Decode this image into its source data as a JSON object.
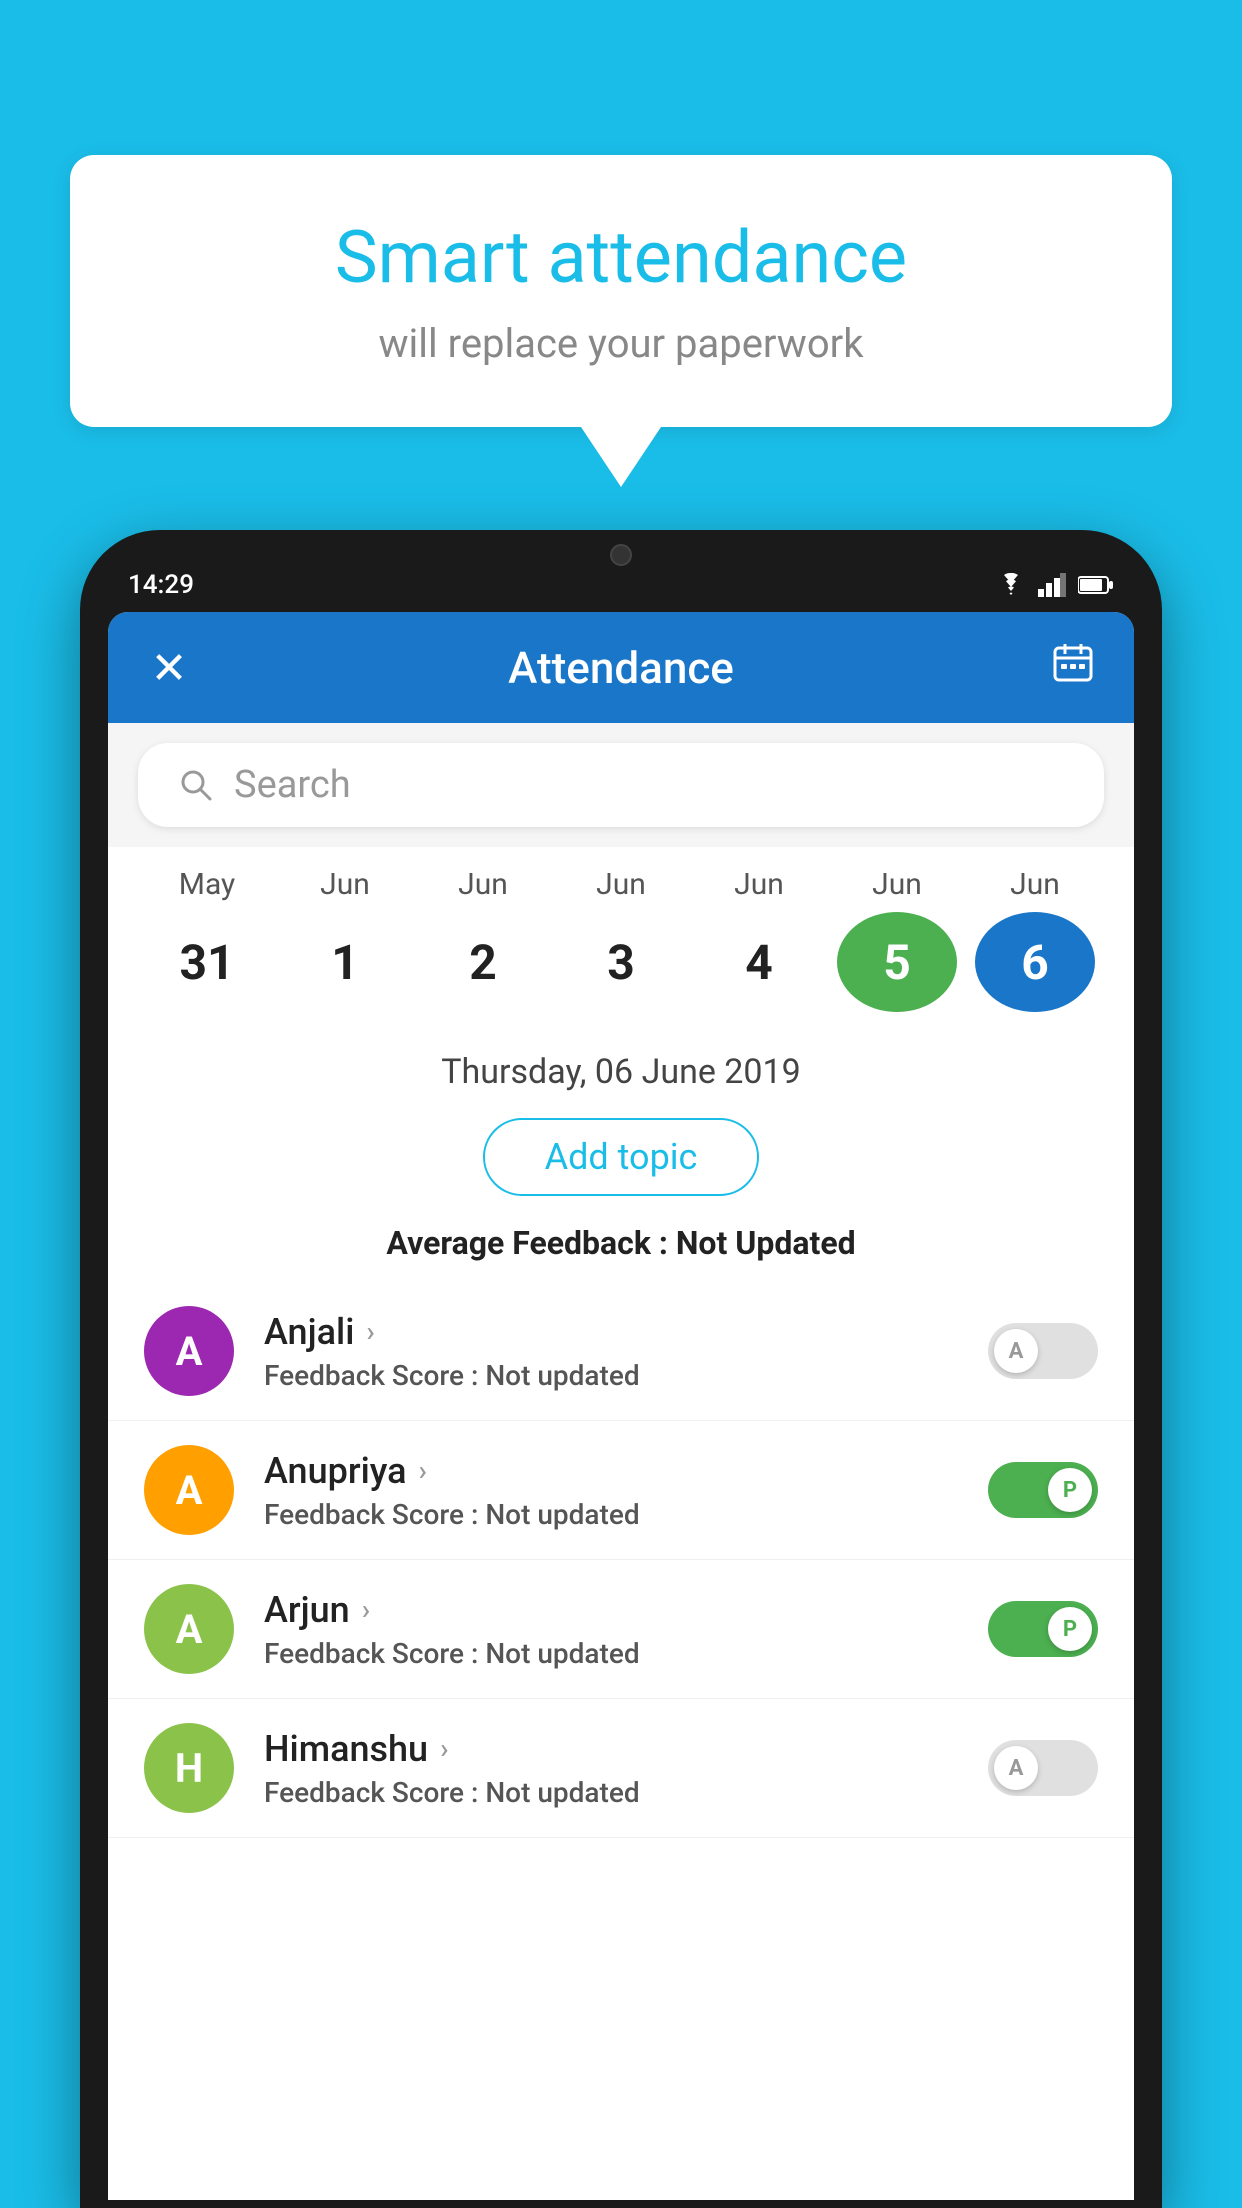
{
  "background_color": "#1ABDE8",
  "speech_bubble": {
    "title": "Smart attendance",
    "subtitle": "will replace your paperwork"
  },
  "phone": {
    "status_bar": {
      "time": "14:29",
      "icons": [
        "wifi",
        "signal",
        "battery"
      ]
    },
    "header": {
      "close_label": "✕",
      "title": "Attendance",
      "calendar_icon": "📅"
    },
    "search": {
      "placeholder": "Search"
    },
    "calendar": {
      "months": [
        "May",
        "Jun",
        "Jun",
        "Jun",
        "Jun",
        "Jun",
        "Jun"
      ],
      "dates": [
        "31",
        "1",
        "2",
        "3",
        "4",
        "5",
        "6"
      ],
      "active_green_index": 5,
      "active_blue_index": 6
    },
    "selected_date": "Thursday, 06 June 2019",
    "add_topic_label": "Add topic",
    "avg_feedback_label": "Average Feedback :",
    "avg_feedback_value": "Not Updated",
    "students": [
      {
        "name": "Anjali",
        "avatar_letter": "A",
        "avatar_color": "#9C27B0",
        "feedback_label": "Feedback Score :",
        "feedback_value": "Not updated",
        "toggle_state": "off",
        "toggle_letter": "A"
      },
      {
        "name": "Anupriya",
        "avatar_letter": "A",
        "avatar_color": "#FFA000",
        "feedback_label": "Feedback Score :",
        "feedback_value": "Not updated",
        "toggle_state": "on",
        "toggle_letter": "P"
      },
      {
        "name": "Arjun",
        "avatar_letter": "A",
        "avatar_color": "#8BC34A",
        "feedback_label": "Feedback Score :",
        "feedback_value": "Not updated",
        "toggle_state": "on",
        "toggle_letter": "P"
      },
      {
        "name": "Himanshu",
        "avatar_letter": "H",
        "avatar_color": "#8BC34A",
        "feedback_label": "Feedback Score :",
        "feedback_value": "Not updated",
        "toggle_state": "off",
        "toggle_letter": "A"
      }
    ]
  }
}
